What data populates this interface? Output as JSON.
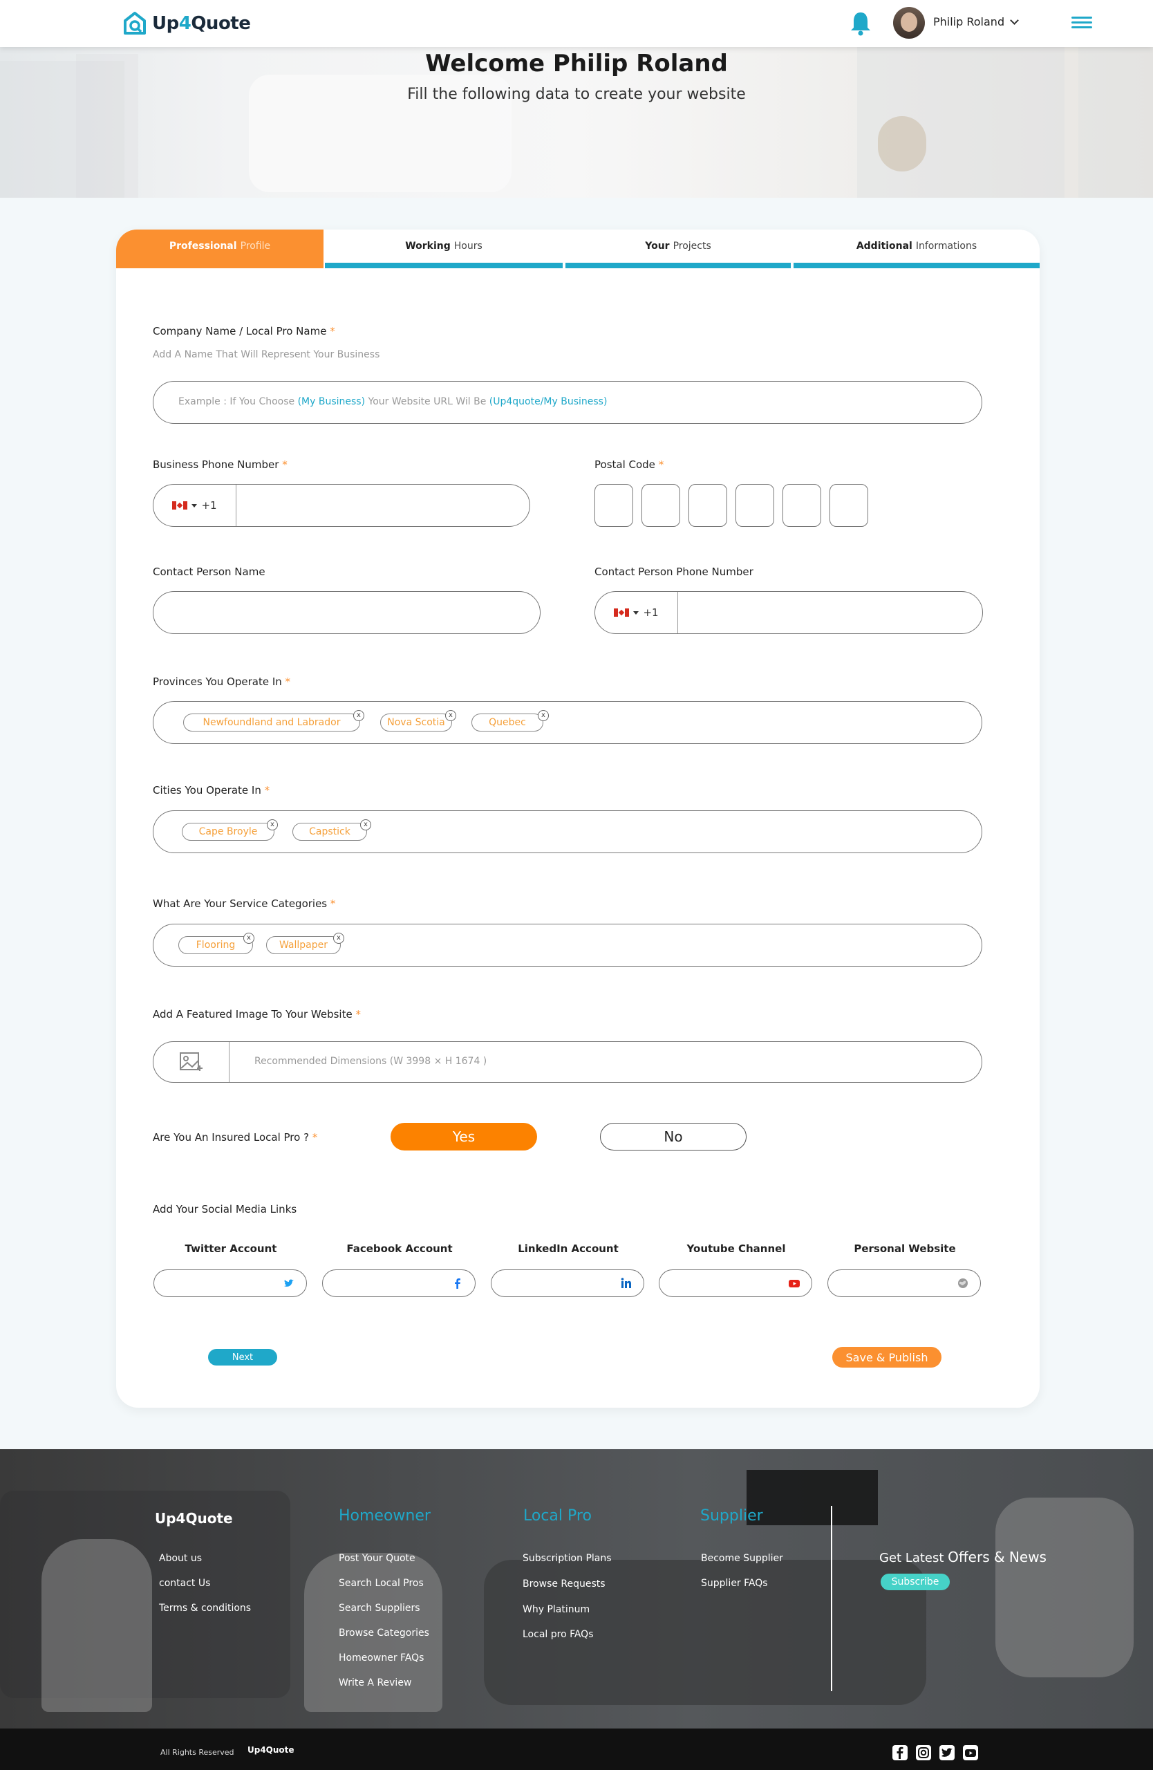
{
  "header": {
    "brand": "Up4Quote",
    "brand_pre": "Up",
    "brand_mid": "4",
    "brand_post": "Quote",
    "user_name": "Philip Roland"
  },
  "hero": {
    "title": "Welcome Philip Roland",
    "subtitle": "Fill the following data to create your website"
  },
  "tabs": [
    {
      "bold": "Professional",
      "rest": "Profile"
    },
    {
      "bold": "Working",
      "rest": "Hours"
    },
    {
      "bold": "Your",
      "rest": "Projects"
    },
    {
      "bold": "Additional",
      "rest": "Informations"
    }
  ],
  "form": {
    "company_label": "Company Name / Local Pro Name",
    "company_hint": "Add A Name That Will Represent Your Business",
    "company_ph_1": "Example : If You Choose ",
    "company_ph_hl1": "(My Business)",
    "company_ph_2": " Your Website URL Wil Be ",
    "company_ph_hl2": "(Up4quote/My Business)",
    "phone_label": "Business Phone Number",
    "dial_code": "+1",
    "postal_label": "Postal Code",
    "contact_name_label": "Contact Person Name",
    "contact_phone_label": "Contact Person Phone Number",
    "provinces_label": "Provinces You Operate In",
    "provinces": [
      "Newfoundland and Labrador",
      "Nova Scotia",
      "Quebec"
    ],
    "cities_label": "Cities You Operate In",
    "cities": [
      "Cape Broyle",
      "Capstick"
    ],
    "categories_label": "What Are Your Service Categories",
    "categories": [
      "Flooring",
      "Wallpaper"
    ],
    "image_label": "Add A Featured Image To Your Website",
    "image_ph": "Recommended Dimensions (W 3998 × H 1674 )",
    "insured_label": "Are You An Insured Local Pro ?",
    "yes": "Yes",
    "no": "No",
    "social_label": "Add Your Social Media Links",
    "social": [
      {
        "label": "Twitter Account",
        "icon": "twitter-icon"
      },
      {
        "label": "Facebook Account",
        "icon": "facebook-icon"
      },
      {
        "label": "LinkedIn Account",
        "icon": "linkedin-icon"
      },
      {
        "label": "Youtube Channel",
        "icon": "youtube-icon"
      },
      {
        "label": "Personal Website",
        "icon": "globe-icon"
      }
    ],
    "next": "Next",
    "save": "Save & Publish",
    "required_mark": "*"
  },
  "footer": {
    "brand": "Up4Quote",
    "col1": [
      "About us",
      "contact Us",
      "Terms & conditions"
    ],
    "col2_title": "Homeowner",
    "col2": [
      "Post Your Quote",
      "Search Local Pros",
      "Search Suppliers",
      "Browse Categories",
      "Homeowner FAQs",
      "Write A Review"
    ],
    "col3_title": "Local Pro",
    "col3": [
      "Subscription Plans",
      "Browse Requests",
      "Why Platinum",
      "Local pro FAQs"
    ],
    "col4_title": "Supplier",
    "col4": [
      "Become Supplier",
      "Supplier FAQs"
    ],
    "offers_1": "Get Latest ",
    "offers_2": "Offers & News",
    "subscribe": "Subscribe",
    "rights": "All Rights Reserved",
    "mini_brand": "Up4Quote"
  },
  "colors": {
    "accent": "#1fa8c9",
    "orange": "#fb9030",
    "yes_orange": "#fc8200",
    "subscribe": "#46d2c8"
  }
}
